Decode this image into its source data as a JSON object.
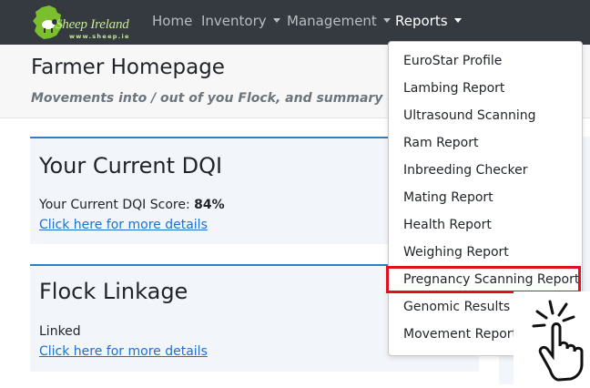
{
  "navbar": {
    "logo": {
      "brand": "Sheep Ireland",
      "url": "www.sheep.ie"
    },
    "links": [
      {
        "label": "Home"
      },
      {
        "label": "Inventory"
      },
      {
        "label": "Management"
      },
      {
        "label": "Reports"
      }
    ],
    "colors": {
      "background": "#343a40",
      "logo_green": "#7bbf2e"
    }
  },
  "header": {
    "title": "Farmer Homepage",
    "subtitle": "Movements into / out of you Flock, and summary of you"
  },
  "dqi_card": {
    "title": "Your Current DQI",
    "score_label": "Your Current DQI Score: ",
    "score_value": "84%",
    "link": "Click here for more details"
  },
  "linkage_card": {
    "title": "Flock Linkage",
    "status": "Linked",
    "link": "Click here for more details"
  },
  "reports_menu": {
    "items": [
      "EuroStar Profile",
      "Lambing Report",
      "Ultrasound Scanning",
      "Ram Report",
      "Inbreeding Checker",
      "Mating Report",
      "Health Report",
      "Weighing Report",
      "Pregnancy Scanning Report",
      "Genomic Results",
      "Movement Report"
    ],
    "highlighted_item": "Pregnancy Scanning Report",
    "highlight_color": "#e0101f"
  },
  "icons": {
    "logo": "ireland-map-sheep-icon",
    "cursor": "hand-pointer-click-icon"
  }
}
